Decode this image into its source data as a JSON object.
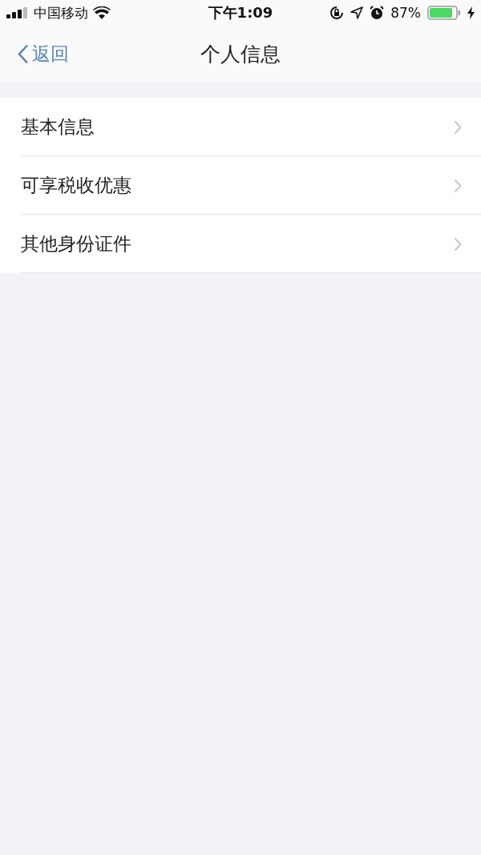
{
  "status_bar": {
    "carrier": "中国移动",
    "time": "下午1:09",
    "battery": "87%"
  },
  "nav_bar": {
    "back": "返回",
    "title": "个人信息"
  },
  "menu": [
    {
      "label": "基本信息"
    },
    {
      "label": "可享税收优惠"
    },
    {
      "label": "其他身份证件"
    }
  ]
}
